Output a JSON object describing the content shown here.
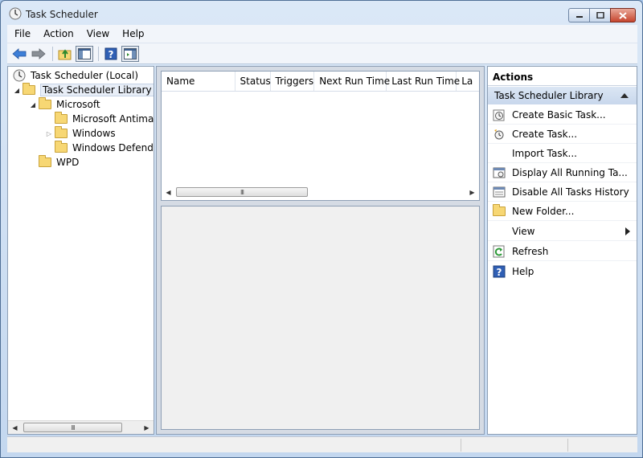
{
  "window": {
    "title": "Task Scheduler"
  },
  "menu": [
    {
      "label": "File"
    },
    {
      "label": "Action"
    },
    {
      "label": "View"
    },
    {
      "label": "Help"
    }
  ],
  "toolbar": {
    "icons": [
      "back-arrow-icon",
      "forward-arrow-icon",
      "up-folder-icon",
      "show-hide-console-tree-icon",
      "help-icon",
      "show-hide-action-pane-icon"
    ]
  },
  "tree": {
    "root": "Task Scheduler (Local)",
    "library": "Task Scheduler Library",
    "microsoft": "Microsoft",
    "antimalware": "Microsoft Antimalware",
    "windows": "Windows",
    "defender": "Windows Defender",
    "wpd": "WPD",
    "scroll_thumb": "III"
  },
  "list": {
    "columns": [
      "Name",
      "Status",
      "Triggers",
      "Next Run Time",
      "Last Run Time",
      "La"
    ],
    "scroll_thumb": "III"
  },
  "actions": {
    "title": "Actions",
    "section": "Task Scheduler Library",
    "items": [
      {
        "label": "Create Basic Task..."
      },
      {
        "label": "Create Task..."
      },
      {
        "label": "Import Task..."
      },
      {
        "label": "Display All Running Ta..."
      },
      {
        "label": "Disable All Tasks History"
      },
      {
        "label": "New Folder..."
      },
      {
        "label": "View"
      },
      {
        "label": "Refresh"
      },
      {
        "label": "Help"
      }
    ]
  },
  "colors": {
    "frame": "#c3d7ef",
    "selection": "#e8eef7",
    "folder": "#f7d774",
    "close_button": "#c6452e"
  }
}
